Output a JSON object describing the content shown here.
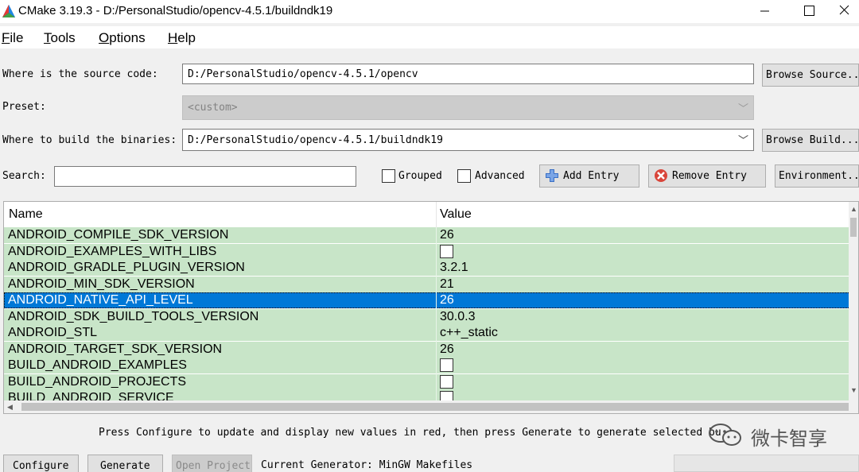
{
  "window": {
    "title": "CMake 3.19.3 - D:/PersonalStudio/opencv-4.5.1/buildndk19"
  },
  "menu": [
    "File",
    "Tools",
    "Options",
    "Help"
  ],
  "source": {
    "label": "Where is the source code:",
    "value": "D:/PersonalStudio/opencv-4.5.1/opencv",
    "browse_button": "Browse Source.."
  },
  "preset": {
    "label": "Preset:",
    "value": "<custom>"
  },
  "build": {
    "label": "Where to build the binaries:",
    "value": "D:/PersonalStudio/opencv-4.5.1/buildndk19",
    "browse_button": "Browse Build..."
  },
  "search": {
    "label": "Search:",
    "value": ""
  },
  "options": {
    "grouped": {
      "label": "Grouped",
      "checked": false
    },
    "advanced": {
      "label": "Advanced",
      "checked": false
    }
  },
  "buttons": {
    "add_entry": "Add Entry",
    "remove_entry": "Remove Entry",
    "environment": "Environment..",
    "configure": "Configure",
    "generate": "Generate",
    "open_project": "Open Project"
  },
  "table": {
    "columns": [
      "Name",
      "Value"
    ],
    "rows": [
      {
        "name": "ANDROID_COMPILE_SDK_VERSION",
        "value": "26",
        "type": "text",
        "selected": false
      },
      {
        "name": "ANDROID_EXAMPLES_WITH_LIBS",
        "value": "",
        "type": "bool",
        "checked": false,
        "selected": false
      },
      {
        "name": "ANDROID_GRADLE_PLUGIN_VERSION",
        "value": "3.2.1",
        "type": "text",
        "selected": false
      },
      {
        "name": "ANDROID_MIN_SDK_VERSION",
        "value": "21",
        "type": "text",
        "selected": false
      },
      {
        "name": "ANDROID_NATIVE_API_LEVEL",
        "value": "26",
        "type": "text",
        "selected": true
      },
      {
        "name": "ANDROID_SDK_BUILD_TOOLS_VERSION",
        "value": "30.0.3",
        "type": "text",
        "selected": false
      },
      {
        "name": "ANDROID_STL",
        "value": "c++_static",
        "type": "text",
        "selected": false
      },
      {
        "name": "ANDROID_TARGET_SDK_VERSION",
        "value": "26",
        "type": "text",
        "selected": false
      },
      {
        "name": "BUILD_ANDROID_EXAMPLES",
        "value": "",
        "type": "bool",
        "checked": false,
        "selected": false
      },
      {
        "name": "BUILD_ANDROID_PROJECTS",
        "value": "",
        "type": "bool",
        "checked": false,
        "selected": false
      },
      {
        "name": "BUILD_ANDROID_SERVICE",
        "value": "",
        "type": "bool",
        "checked": false,
        "selected": false
      }
    ]
  },
  "status": {
    "message": "Press Configure to update and display new values in red, then press Generate to generate selected bu",
    "generator": "Current Generator: MinGW Makefiles"
  },
  "watermark": {
    "text": "微卡智享"
  },
  "colors": {
    "row_green": "#c8e5c8",
    "selection_blue": "#0078d7",
    "window_bg": "#f0f0f0"
  }
}
